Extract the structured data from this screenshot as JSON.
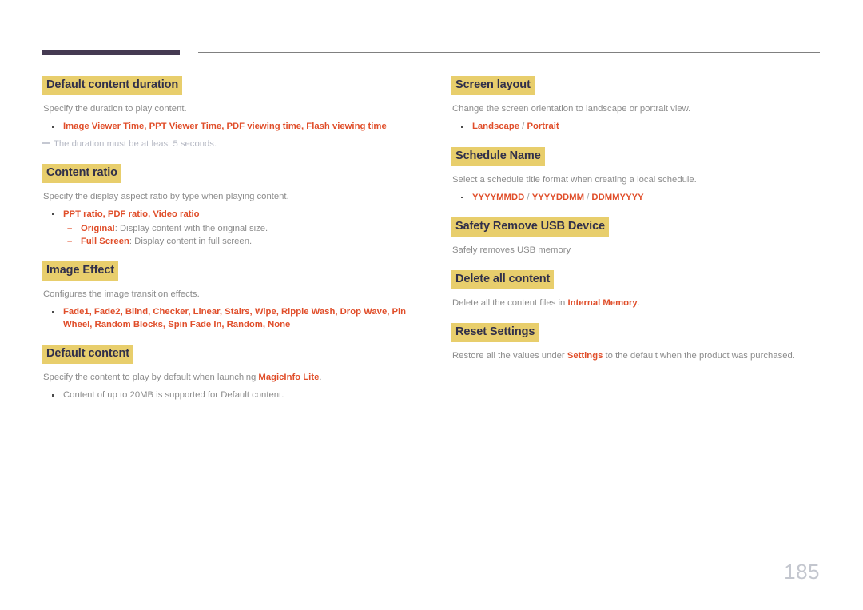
{
  "page": {
    "number": "185",
    "accent_color": "#e04e2a",
    "highlight_color": "#e8ce6c",
    "heading_text_color": "#31304a",
    "rule_color": "#453a52",
    "body_text_color": "#8c8c8c"
  },
  "left_column": {
    "sections": [
      {
        "heading": "Default content duration",
        "desc": "Specify the duration to play content.",
        "bullets": [
          "Image Viewer Time, PPT Viewer Time, PDF viewing time, Flash viewing time"
        ],
        "note": "The duration must be at least 5 seconds."
      },
      {
        "heading": "Content ratio",
        "desc": "Specify the display aspect ratio by type when playing content.",
        "bullets": [
          "PPT ratio, PDF ratio, Video ratio"
        ],
        "sub_items": [
          {
            "term": "Original",
            "text": ": Display content with the original size."
          },
          {
            "term": "Full Screen",
            "text": ": Display content in full screen."
          }
        ]
      },
      {
        "heading": "Image Effect",
        "desc": "Configures the image transition effects.",
        "bullets": [
          "Fade1, Fade2, Blind, Checker, Linear, Stairs, Wipe, Ripple Wash, Drop Wave, Pin Wheel, Random Blocks, Spin Fade In, Random, None"
        ]
      },
      {
        "heading": "Default content",
        "desc_prefix": "Specify the content to play by default when launching ",
        "desc_accent": "MagicInfo Lite",
        "desc_suffix": ".",
        "plain_bullet_prefix": "Content of up to 20MB is supported for ",
        "plain_bullet_accent": "Default content",
        "plain_bullet_suffix": "."
      }
    ]
  },
  "right_column": {
    "sections": [
      {
        "heading": "Screen layout",
        "desc": "Change the screen orientation to landscape or portrait view.",
        "bullet_a": "Landscape",
        "bullet_sep": " / ",
        "bullet_b": "Portrait"
      },
      {
        "heading": "Schedule Name",
        "desc": "Select a schedule title format when creating a local schedule.",
        "bullet_a": "YYYYMMDD",
        "bullet_sep1": " / ",
        "bullet_b": "YYYYDDMM",
        "bullet_sep2": " / ",
        "bullet_c": "DDMMYYYY"
      },
      {
        "heading": "Safety Remove USB Device",
        "desc": "Safely removes USB memory"
      },
      {
        "heading": "Delete all content",
        "desc_prefix": "Delete all the content files in ",
        "desc_accent": "Internal Memory",
        "desc_suffix": "."
      },
      {
        "heading": "Reset Settings",
        "desc_prefix": "Restore all the values under ",
        "desc_accent": "Settings",
        "desc_suffix": " to the default when the product was purchased."
      }
    ]
  }
}
